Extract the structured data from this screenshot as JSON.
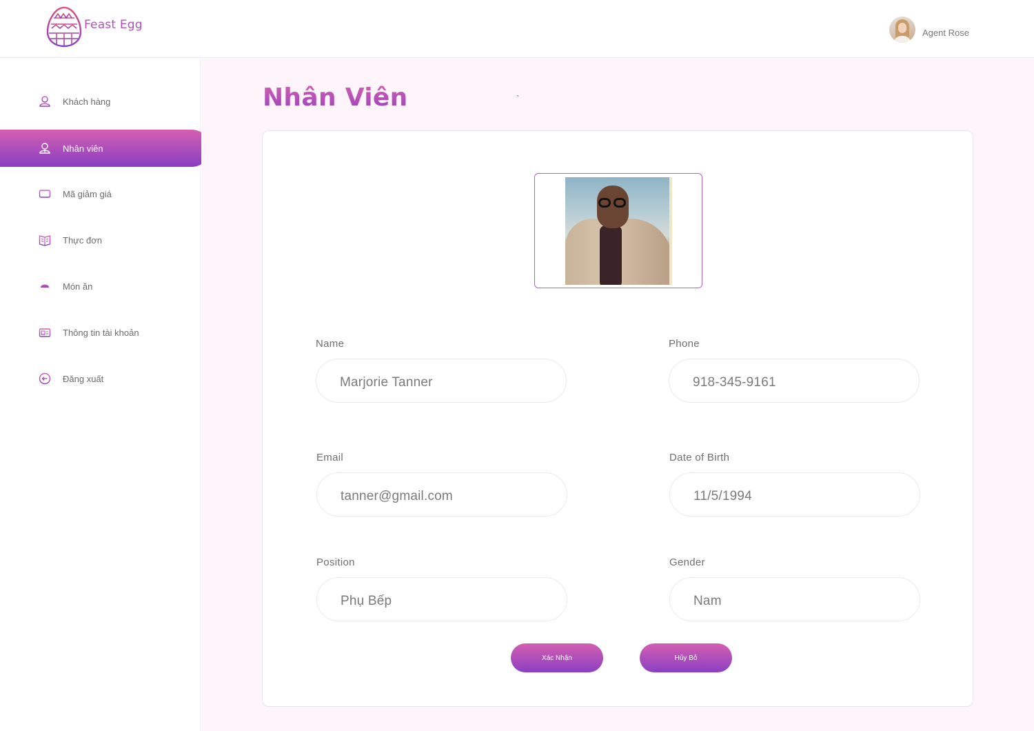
{
  "brand": {
    "name": "Feast Egg",
    "accent": "#b04fb8",
    "gradient_from": "#d45fb0",
    "gradient_to": "#8a3fc4"
  },
  "user": {
    "name": "Agent Rose"
  },
  "sidebar": {
    "items": [
      {
        "label": "Khách hàng",
        "icon": "user-icon",
        "active": false
      },
      {
        "label": "Nhân viên",
        "icon": "staff-icon",
        "active": true
      },
      {
        "label": "Mã giảm giá",
        "icon": "voucher-icon",
        "active": false
      },
      {
        "label": "Thực đơn",
        "icon": "menu-book-icon",
        "active": false
      },
      {
        "label": "Món ăn",
        "icon": "dish-icon",
        "active": false
      },
      {
        "label": "Thông tin tài khoản",
        "icon": "account-card-icon",
        "active": false
      },
      {
        "label": "Đăng xuất",
        "icon": "logout-icon",
        "active": false
      }
    ]
  },
  "page": {
    "title": "Nhân Viên",
    "stray_mark": "`"
  },
  "form": {
    "name": {
      "label": "Name",
      "value": "Marjorie Tanner"
    },
    "phone": {
      "label": "Phone",
      "value": "918-345-9161"
    },
    "email": {
      "label": "Email",
      "value": "tanner@gmail.com"
    },
    "dob": {
      "label": "Date of Birth",
      "value": "11/5/1994"
    },
    "position": {
      "label": "Position",
      "value": "Phụ Bếp"
    },
    "gender": {
      "label": "Gender",
      "value": "Nam"
    },
    "confirm_label": "Xác Nhận",
    "cancel_label": "Hủy Bỏ"
  }
}
